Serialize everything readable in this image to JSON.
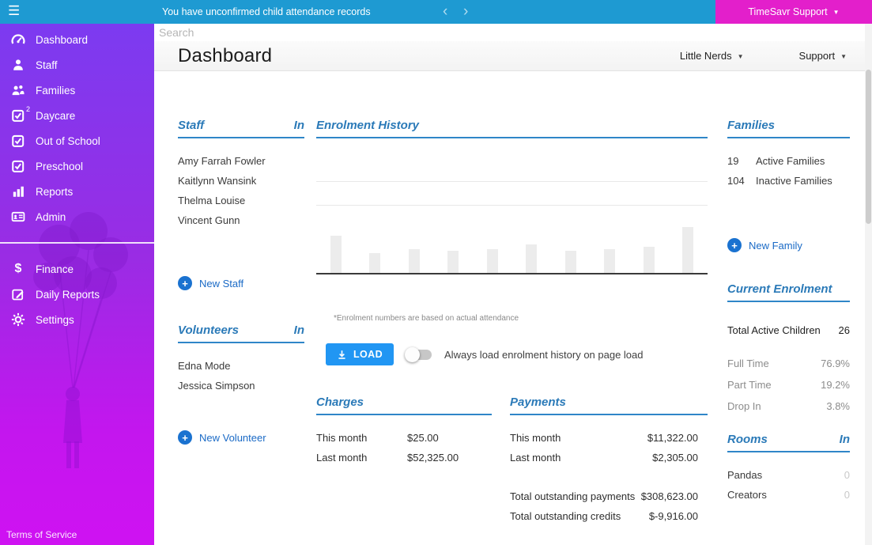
{
  "topbar": {
    "message": "You have unconfirmed child attendance records",
    "support_label": "TimeSavr Support"
  },
  "header": {
    "search_placeholder": "Search",
    "title": "Dashboard",
    "org_selector": "Little Nerds",
    "support_selector": "Support"
  },
  "sidebar": {
    "items": [
      {
        "label": "Dashboard"
      },
      {
        "label": "Staff"
      },
      {
        "label": "Families"
      },
      {
        "label": "Daycare",
        "badge": "2"
      },
      {
        "label": "Out of School"
      },
      {
        "label": "Preschool"
      },
      {
        "label": "Reports"
      },
      {
        "label": "Admin"
      }
    ],
    "secondary_items": [
      {
        "label": "Finance"
      },
      {
        "label": "Daily Reports"
      },
      {
        "label": "Settings"
      }
    ],
    "footer_link": "Terms of Service"
  },
  "staff": {
    "title": "Staff",
    "in_label": "In",
    "members": [
      "Amy Farrah Fowler",
      "Kaitlynn Wansink",
      "Thelma Louise",
      "Vincent Gunn"
    ],
    "new_label": "New Staff"
  },
  "volunteers": {
    "title": "Volunteers",
    "in_label": "In",
    "members": [
      "Edna Mode",
      "Jessica Simpson"
    ],
    "new_label": "New Volunteer"
  },
  "enrolment": {
    "title": "Enrolment History",
    "note": "*Enrolment numbers are based on actual attendance",
    "load_label": "LOAD",
    "toggle_label": "Always load enrolment history on page load",
    "toggle_on": false
  },
  "chart_data": {
    "type": "bar",
    "title": "Enrolment History",
    "categories": [
      "",
      "",
      "",
      "",
      "",
      "",
      "",
      "",
      "",
      ""
    ],
    "values": [
      47,
      25,
      30,
      28,
      30,
      36,
      28,
      30,
      33,
      58
    ],
    "unit": "approximate relative heights — axes are unlabeled in the UI",
    "bar_color": "#ececec",
    "gridlines": true,
    "note": "*Enrolment numbers are based on actual attendance"
  },
  "charges": {
    "title": "Charges",
    "rows": [
      {
        "label": "This month",
        "value": "$25.00"
      },
      {
        "label": "Last month",
        "value": "$52,325.00"
      }
    ]
  },
  "payments": {
    "title": "Payments",
    "rows": [
      {
        "label": "This month",
        "value": "$11,322.00"
      },
      {
        "label": "Last month",
        "value": "$2,305.00"
      }
    ],
    "totals": [
      {
        "label": "Total outstanding payments",
        "value": "$308,623.00"
      },
      {
        "label": "Total outstanding credits",
        "value": "$-9,916.00"
      }
    ]
  },
  "families": {
    "title": "Families",
    "stats": [
      {
        "count": "19",
        "label": "Active Families"
      },
      {
        "count": "104",
        "label": "Inactive Families"
      }
    ],
    "new_label": "New Family"
  },
  "current_enrolment": {
    "title": "Current Enrolment",
    "total_label": "Total Active Children",
    "total_value": "26",
    "breakdown": [
      {
        "label": "Full Time",
        "value": "76.9%"
      },
      {
        "label": "Part Time",
        "value": "19.2%"
      },
      {
        "label": "Drop In",
        "value": "3.8%"
      }
    ]
  },
  "rooms": {
    "title": "Rooms",
    "in_label": "In",
    "rows": [
      {
        "label": "Pandas",
        "value": "0"
      },
      {
        "label": "Creators",
        "value": "0"
      }
    ]
  },
  "colors": {
    "topbar_blue": "#1e9ad2",
    "topbar_magenta": "#e31fcb",
    "sidebar_gradient_top": "#7c3bf0",
    "sidebar_gradient_bottom": "#cf12f2",
    "section_header_blue": "#2b7ab8",
    "link_blue": "#1a6ac6",
    "load_button_blue": "#2196f3"
  }
}
